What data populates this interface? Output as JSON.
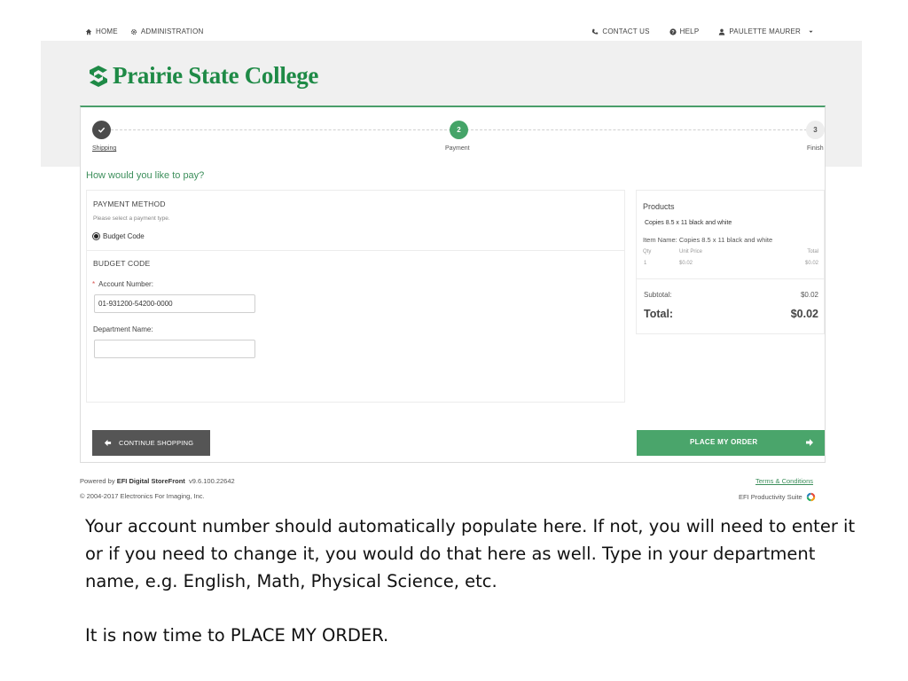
{
  "nav": {
    "home": "HOME",
    "administration": "ADMINISTRATION",
    "contact": "CONTACT US",
    "help": "HELP",
    "user": "PAULETTE MAURER"
  },
  "brand": {
    "name": "Prairie State College",
    "color": "#1e8a46"
  },
  "stepper": {
    "steps": [
      {
        "number": "",
        "label": "Shipping",
        "state": "done"
      },
      {
        "number": "2",
        "label": "Payment",
        "state": "active"
      },
      {
        "number": "3",
        "label": "Finish",
        "state": "todo"
      }
    ]
  },
  "payment": {
    "question": "How would you like to pay?",
    "method_title": "PAYMENT METHOD",
    "method_hint": "Please select a payment type.",
    "method_option": "Budget Code",
    "budget_title": "BUDGET CODE",
    "required_mark": "*",
    "account_label": "Account Number:",
    "account_value": "01-931200-54200-0000",
    "department_label": "Department Name:",
    "department_value": ""
  },
  "summary": {
    "title": "Products",
    "product_name": "Copies 8.5 x 11 black and white",
    "item_name": "Item Name: Copies 8.5 x 11 black and white",
    "headers": {
      "qty": "Qty",
      "unit_price": "Unit Price",
      "total": "Total"
    },
    "row": {
      "qty": "1",
      "unit_price": "$0.02",
      "total": "$0.02"
    },
    "subtotal_label": "Subtotal:",
    "subtotal_value": "$0.02",
    "total_label": "Total:",
    "total_value": "$0.02"
  },
  "buttons": {
    "continue": "CONTINUE SHOPPING",
    "place_order": "PLACE MY ORDER"
  },
  "footer": {
    "powered_prefix": "Powered by",
    "powered_name": "EFI Digital StoreFront",
    "version": "v9.6.100.22642",
    "copyright": "© 2004-2017 Electronics For Imaging, Inc.",
    "terms": "Terms & Conditions",
    "suite": "EFI Productivity Suite"
  },
  "caption": {
    "para1": "Your account number should automatically populate here. If not, you will need to enter it or if you need to change it, you would do that here as well. Type in your department name, e.g. English, Math, Physical Science, etc.",
    "para2": "It is now time to PLACE MY ORDER."
  },
  "colors": {
    "accent_green": "#45a468",
    "dark_button": "#555555"
  }
}
